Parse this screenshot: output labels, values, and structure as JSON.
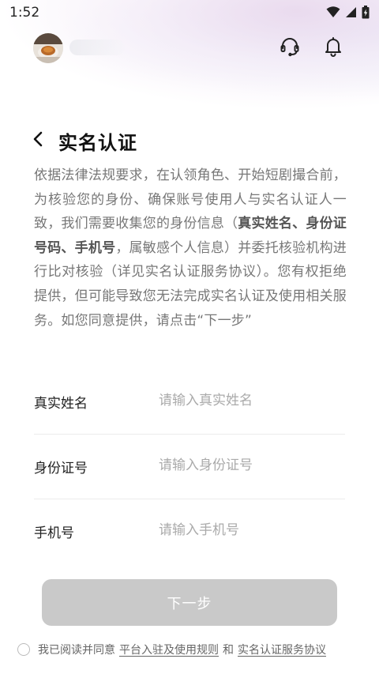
{
  "status_bar": {
    "time": "1:52"
  },
  "top_bar": {
    "username": "",
    "support_icon": "headset-icon",
    "bell_icon": "bell-icon"
  },
  "page": {
    "title": "实名认证",
    "intro": {
      "part1": "依据法律法规要求，在认领角色、开始短剧撮合前，为核验您的身份、确保账号使用人与实名认证人一致，我们需要收集您的身份信息（",
      "bold": "真实姓名、身份证号码、手机号",
      "part2": "，属敏感个人信息）并委托核验机构进行比对核验（详见实名认证服务协议）。您有权拒绝提供，但可能导致您无法完成实名认证及使用相关服务。如您同意提供，请点击“下一步”"
    }
  },
  "form": {
    "name": {
      "label": "真实姓名",
      "placeholder": "请输入真实姓名"
    },
    "id_number": {
      "label": "身份证号",
      "placeholder": "请输入身份证号"
    },
    "phone": {
      "label": "手机号",
      "placeholder": "请输入手机号"
    }
  },
  "next_button": {
    "label": "下一步"
  },
  "agreement": {
    "prefix": "我已阅读并同意",
    "link1": "平台入驻及使用规则",
    "conjunction": "和",
    "link2": "实名认证服务协议"
  },
  "colors": {
    "button_disabled": "#c9c9c9",
    "text_primary": "#222222",
    "text_secondary": "#777777",
    "placeholder": "#aaaaaa"
  }
}
